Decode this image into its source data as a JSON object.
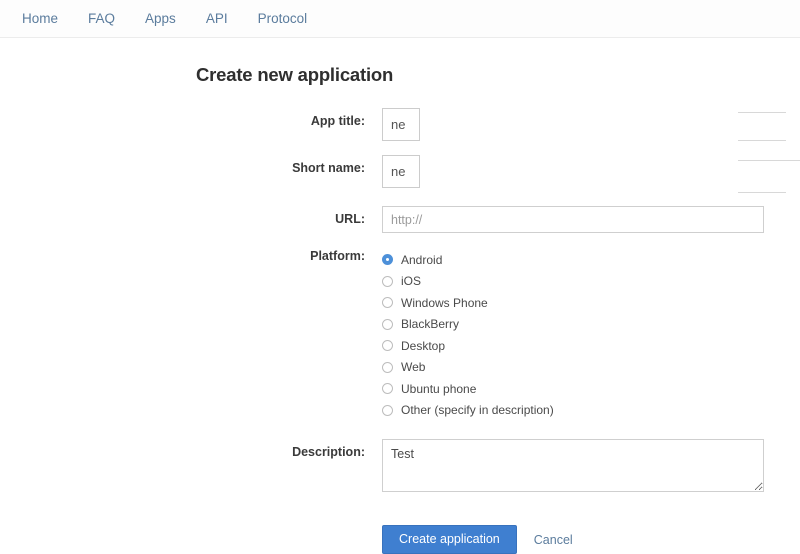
{
  "nav": {
    "items": [
      {
        "label": "Home",
        "name": "nav-link-home"
      },
      {
        "label": "FAQ",
        "name": "nav-link-faq"
      },
      {
        "label": "Apps",
        "name": "nav-link-apps"
      },
      {
        "label": "API",
        "name": "nav-link-api"
      },
      {
        "label": "Protocol",
        "name": "nav-link-protocol"
      }
    ]
  },
  "page": {
    "title": "Create new application"
  },
  "form": {
    "app_title": {
      "label": "App title:",
      "value": "ne"
    },
    "short_name": {
      "label": "Short name:",
      "value": "ne"
    },
    "url": {
      "label": "URL:",
      "value": "",
      "placeholder": "http://"
    },
    "platform": {
      "label": "Platform:",
      "selected": "Android",
      "options": [
        "Android",
        "iOS",
        "Windows Phone",
        "BlackBerry",
        "Desktop",
        "Web",
        "Ubuntu phone",
        "Other (specify in description)"
      ]
    },
    "description": {
      "label": "Description:",
      "value": "Test",
      "placeholder": ""
    }
  },
  "actions": {
    "submit_label": "Create application",
    "cancel_label": "Cancel"
  },
  "colors": {
    "nav_link": "#5b7c9d",
    "primary_button": "#3f7fd0",
    "radio_checked": "#4d90d9",
    "page_background": "#ffffff",
    "input_border": "#cfcfcf"
  }
}
